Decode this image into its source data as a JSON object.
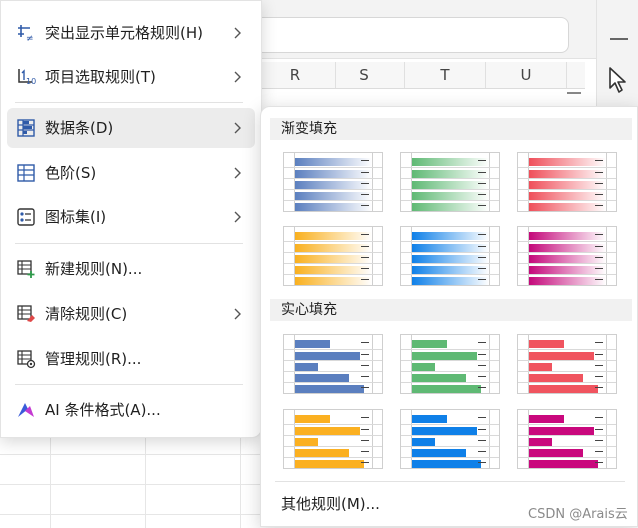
{
  "sheet": {
    "columns": [
      "R",
      "S",
      "T",
      "U"
    ]
  },
  "menu": {
    "items": [
      {
        "label": "突出显示单元格规则(H)",
        "icon": "highlight-rules-icon",
        "submenu": true
      },
      {
        "label": "项目选取规则(T)",
        "icon": "top-bottom-rules-icon",
        "submenu": true
      },
      {
        "label": "数据条(D)",
        "icon": "data-bars-icon",
        "submenu": true,
        "active": true
      },
      {
        "label": "色阶(S)",
        "icon": "color-scales-icon",
        "submenu": true
      },
      {
        "label": "图标集(I)",
        "icon": "icon-sets-icon",
        "submenu": true
      },
      {
        "label": "新建规则(N)...",
        "icon": "new-rule-icon",
        "submenu": false
      },
      {
        "label": "清除规则(C)",
        "icon": "clear-rules-icon",
        "submenu": true
      },
      {
        "label": "管理规则(R)...",
        "icon": "manage-rules-icon",
        "submenu": false
      },
      {
        "label": "AI 条件格式(A)...",
        "icon": "ai-logo-icon",
        "submenu": false
      }
    ]
  },
  "submenu": {
    "gradient_title": "渐变填充",
    "solid_title": "实心填充",
    "more_rules": "其他规则(M)...",
    "gradient_colors": [
      "#5b7fbf",
      "#5fb974",
      "#ef4f5a",
      "#f9b01f",
      "#0f80e8",
      "#c4087a"
    ],
    "solid_colors": [
      "#5b7fbf",
      "#5fb974",
      "#f0545f",
      "#fbb021",
      "#0f80e8",
      "#c9087d"
    ],
    "bar_fractions": [
      0.45,
      0.85,
      0.3,
      0.7,
      0.9
    ]
  },
  "watermark": "CSDN @Arais云"
}
